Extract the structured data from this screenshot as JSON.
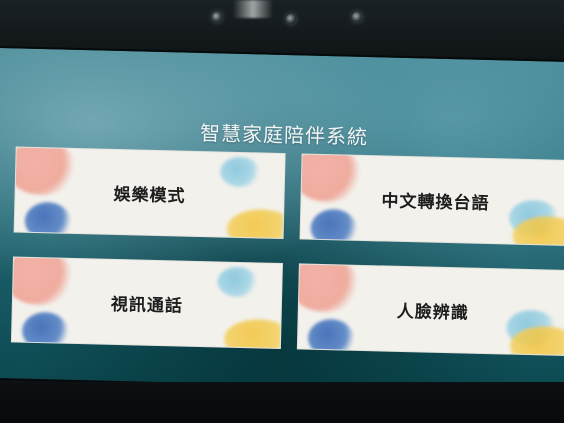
{
  "window": {
    "title": "智慧家庭陪伴系統"
  },
  "menu": {
    "tiles": [
      {
        "label": "娛樂模式"
      },
      {
        "label": "中文轉換台語"
      },
      {
        "label": "視訊通話"
      },
      {
        "label": "人臉辨識"
      }
    ]
  },
  "colors": {
    "screen_teal": "#236a76",
    "tile_bg": "#f3f1ec",
    "title_text": "#f2f6f7",
    "label_text": "#1d1d1d",
    "watercolor_pink": "#eea091",
    "watercolor_blue": "#2d5db2",
    "watercolor_lightblue": "#9fd3e5",
    "watercolor_yellow": "#f2c43c"
  },
  "icons": {
    "device_cameras": [
      "camera-icon",
      "camera-icon",
      "camera-icon"
    ]
  }
}
